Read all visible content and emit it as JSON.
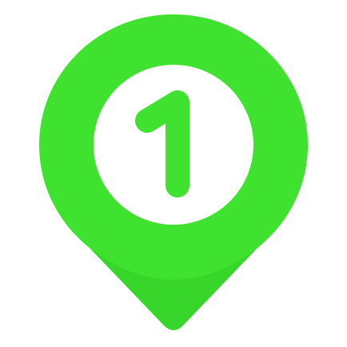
{
  "marker": {
    "icon": "map-pin-number-icon",
    "number": "1",
    "colors": {
      "pin": "#3ee22f",
      "pin_shadow": "#33cc26",
      "inner_circle": "#ffffff",
      "glyph": "#3ee22f"
    }
  }
}
